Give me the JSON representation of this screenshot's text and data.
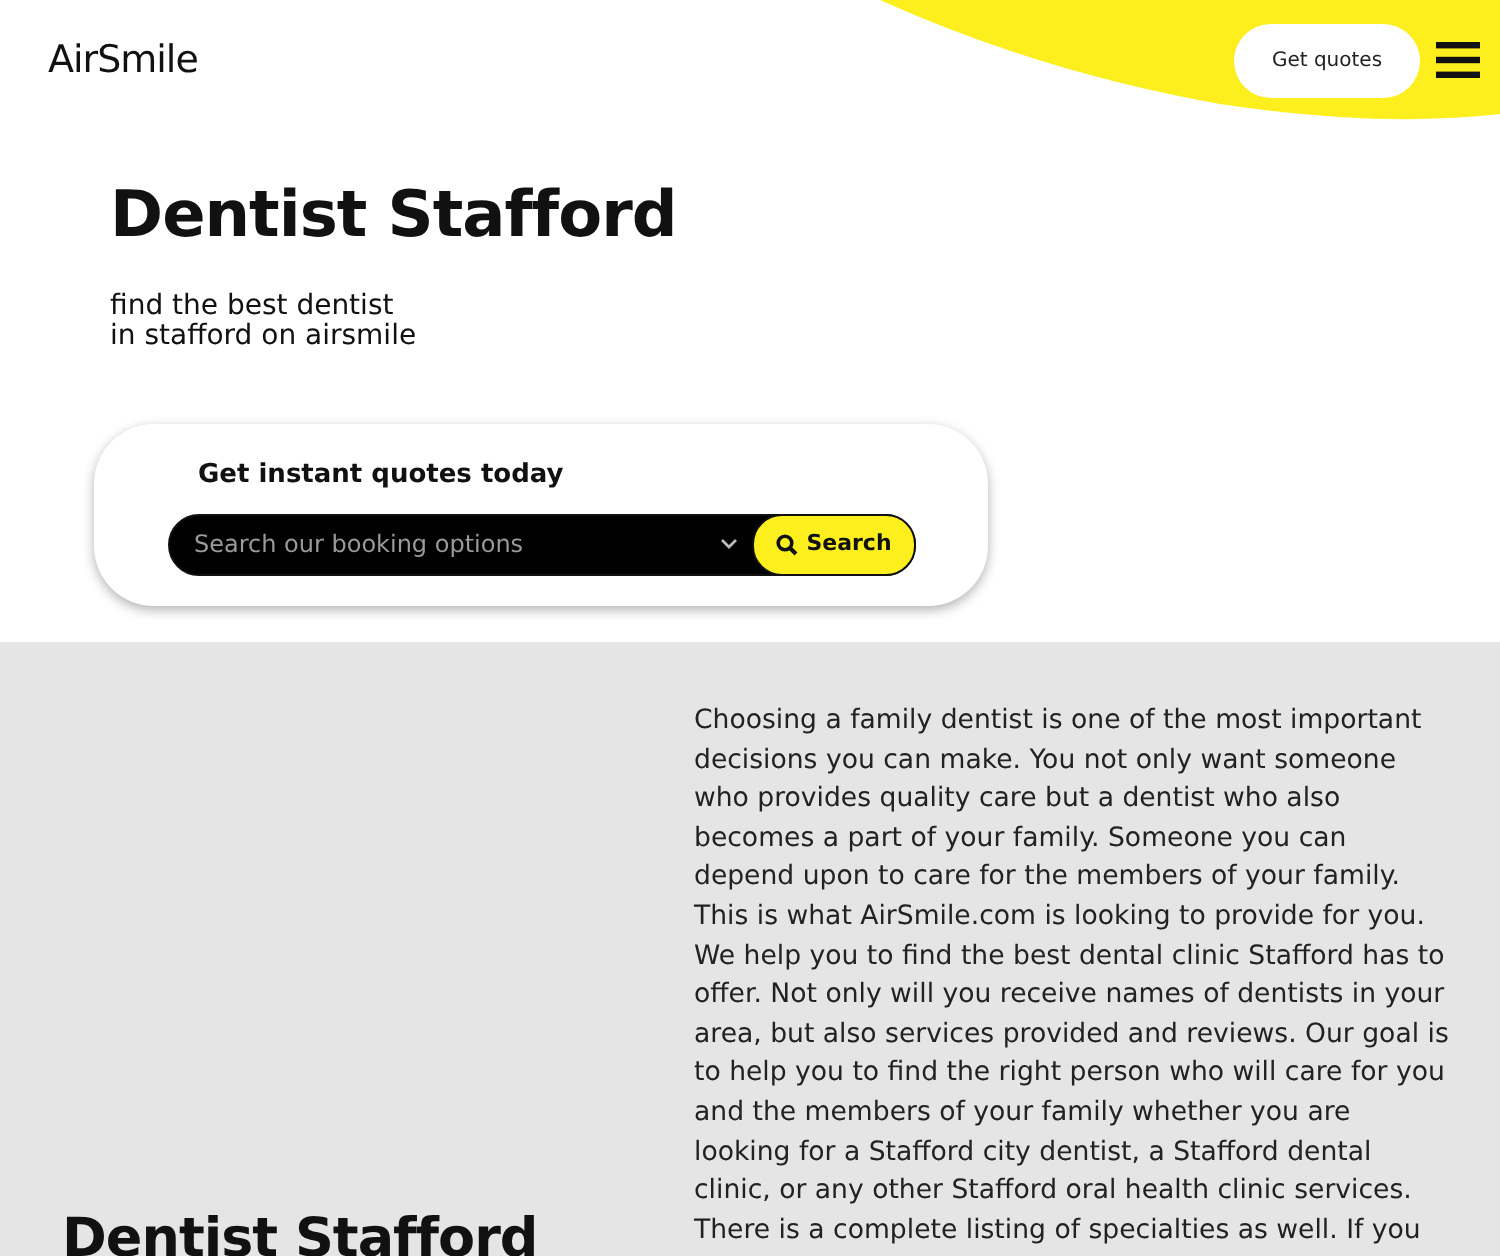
{
  "header": {
    "logo": "AirSmile",
    "cta": "Get quotes"
  },
  "hero": {
    "title": "Dentist Stafford",
    "subtitle_lines": [
      "find the best dentist",
      "in stafford on airsmile"
    ]
  },
  "quote_box": {
    "heading": "Get instant quotes today",
    "placeholder": "Search our booking options",
    "button": "Search"
  },
  "content": {
    "heading": "Dentist Stafford",
    "paragraphs": [
      "Choosing a family dentist is one of the most important decisions you can make. You not only want someone who provides quality care but a dentist who also becomes a part of your family. Someone you can depend upon to care for the members of your family. This is what AirSmile.com is looking to provide for you. We help you to find the best dental clinic Stafford has to offer. Not only will you receive names of dentists in your area, but also services provided and reviews. Our goal is to help you to find the right person who will care for you and the members of your family whether you are looking for a Stafford city dentist, a Stafford dental clinic, or any other Stafford oral health clinic services.",
      "There is a complete listing of specialties as well. If you"
    ]
  }
}
